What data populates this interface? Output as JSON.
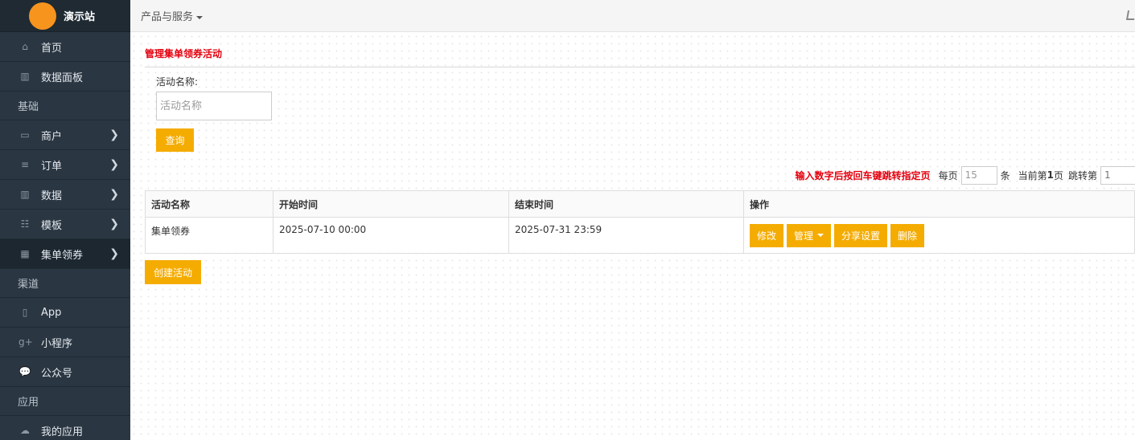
{
  "brand": {
    "name": "演示站"
  },
  "sidebar": {
    "items": [
      {
        "kind": "item",
        "label": "首页",
        "icon": "home-icon",
        "glyph": "⌂",
        "chevron": false
      },
      {
        "kind": "item",
        "label": "数据面板",
        "icon": "bar-chart-icon",
        "glyph": "▥",
        "chevron": false
      },
      {
        "kind": "group",
        "label": "基础"
      },
      {
        "kind": "item",
        "label": "商户",
        "icon": "laptop-icon",
        "glyph": "▭",
        "chevron": true
      },
      {
        "kind": "item",
        "label": "订单",
        "icon": "list-icon",
        "glyph": "≡",
        "chevron": true
      },
      {
        "kind": "item",
        "label": "数据",
        "icon": "bar-chart-icon",
        "glyph": "▥",
        "chevron": true
      },
      {
        "kind": "item",
        "label": "模板",
        "icon": "th-list-icon",
        "glyph": "☷",
        "chevron": true
      },
      {
        "kind": "item",
        "label": "集单领券",
        "icon": "qrcode-icon",
        "glyph": "▦",
        "chevron": true,
        "active": true
      },
      {
        "kind": "group",
        "label": "渠道"
      },
      {
        "kind": "item",
        "label": "App",
        "icon": "tablet-icon",
        "glyph": "▯",
        "chevron": false
      },
      {
        "kind": "item",
        "label": "小程序",
        "icon": "google-plus-icon",
        "glyph": "g+",
        "chevron": false
      },
      {
        "kind": "item",
        "label": "公众号",
        "icon": "comments-icon",
        "glyph": "💬",
        "chevron": false
      },
      {
        "kind": "group",
        "label": "应用"
      },
      {
        "kind": "item",
        "label": "我的应用",
        "icon": "cloud-icon",
        "glyph": "☁",
        "chevron": false
      }
    ]
  },
  "topbar": {
    "menu_label": "产品与服务"
  },
  "main": {
    "title": "管理集单领券活动",
    "search": {
      "label": "活动名称:",
      "placeholder": "活动名称",
      "value": ""
    },
    "query_label": "查询",
    "pager": {
      "hint": "输入数字后按回车键跳转指定页",
      "per_page_prefix": "每页",
      "per_page": "15",
      "per_page_suffix": "条",
      "current_prefix": "当前第",
      "current": "1",
      "current_suffix": "页",
      "jump_label": "跳转第",
      "jump_placeholder": "1"
    },
    "table": {
      "headers": [
        "活动名称",
        "开始时间",
        "结束时间",
        "操作"
      ],
      "rows": [
        {
          "name": "集单领券",
          "start": "2025-07-10 00:00",
          "end": "2025-07-31 23:59"
        }
      ],
      "ops": {
        "edit": "修改",
        "manage": "管理",
        "share": "分享设置",
        "delete": "删除"
      }
    },
    "create_label": "创建活动"
  },
  "colors": {
    "accent": "#f5ac00",
    "danger_text": "#e4000e",
    "sidebar_bg": "#2a3642",
    "logo": "#f7941d"
  }
}
